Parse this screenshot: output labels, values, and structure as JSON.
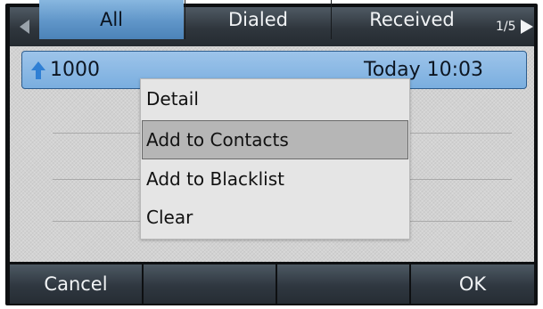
{
  "tabs": [
    {
      "label": "All",
      "active": true
    },
    {
      "label": "Dialed",
      "active": false
    },
    {
      "label": "Received",
      "active": false
    }
  ],
  "pager": "1/5",
  "icons": {
    "scroll_left": "triangle-left-icon",
    "scroll_right": "triangle-right-icon",
    "call_direction": "outgoing-call-arrow-icon"
  },
  "call_entry": {
    "number": "1000",
    "time": "Today 10:03"
  },
  "menu": {
    "items": [
      "Detail",
      "Add to Contacts",
      "Add to Blacklist",
      "Clear"
    ],
    "selected": "Add to Contacts"
  },
  "softkeys": {
    "left": "Cancel",
    "middle1": "",
    "middle2": "",
    "right": "OK"
  },
  "colors": {
    "active_tab": "#6a9fd0",
    "selected_row": "#8bbbe6",
    "call_arrow": "#2f7fd4"
  }
}
